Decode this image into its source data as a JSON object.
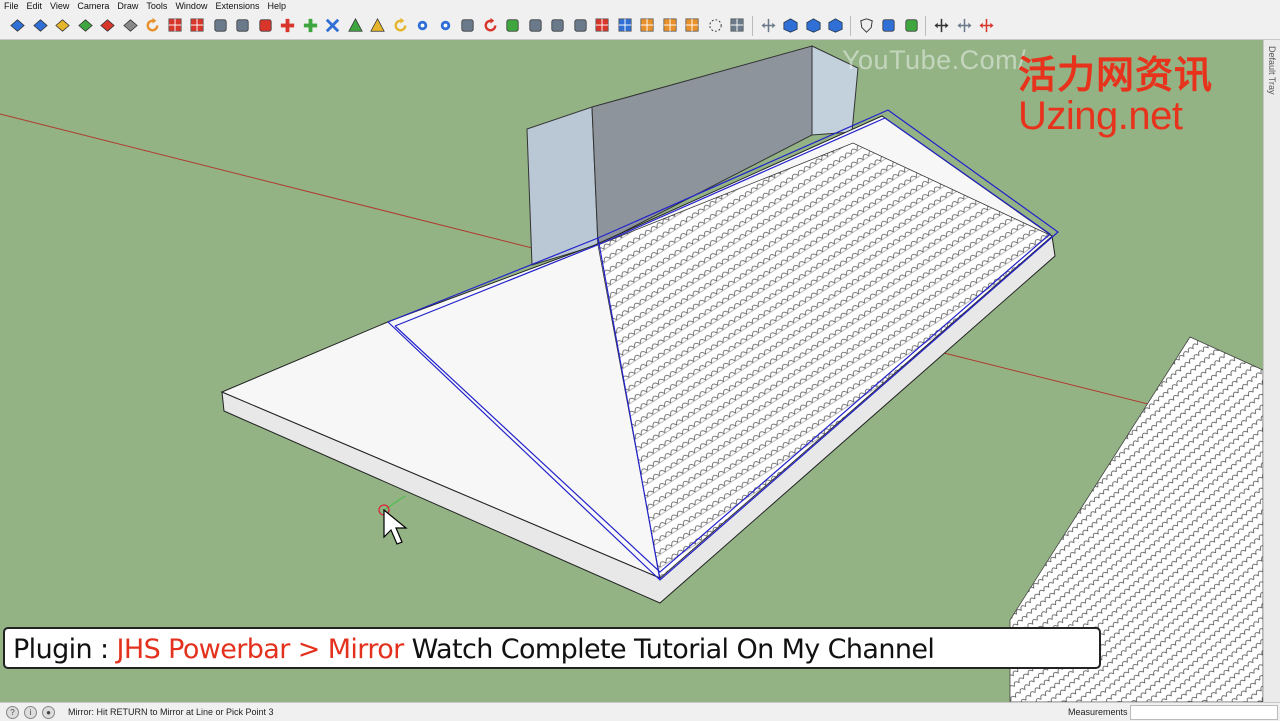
{
  "menu": [
    "File",
    "Edit",
    "View",
    "Camera",
    "Draw",
    "Tools",
    "Window",
    "Extensions",
    "Help"
  ],
  "toolbar": {
    "icons": [
      "push-pull-blue-icon",
      "face-blue-icon",
      "face-yellow-icon",
      "face-green-icon",
      "face-red-icon",
      "face-outline-icon",
      "rotate-orange-icon",
      "grid-red-icon",
      "grid-red-2-icon",
      "flag-icon",
      "corner-icon",
      "curve-red-icon",
      "add-red-icon",
      "add-green-icon",
      "cross-blue-icon",
      "triangle-green-icon",
      "warning-yellow-icon",
      "refresh-yellow-icon",
      "gear-blue-icon",
      "star-blue-icon",
      "bucket-icon",
      "undo-red-icon",
      "puzzle-green-icon",
      "flip-icon",
      "shapes-icon",
      "paint-icon",
      "tile-red-icon",
      "grid-blue-icon",
      "grid-orange-icon",
      "grid-orange-2-icon",
      "grid-orange-3-icon",
      "dotted-circle-icon",
      "dotted-grid-icon",
      "move-icon",
      "cube-blue-icon",
      "cube-blue-2-icon",
      "cube-blue-3-icon",
      "shield-icon",
      "pen-blue-icon",
      "pen-green-icon",
      "arrows-black-icon",
      "mirror-icon",
      "mirror-red-icon"
    ]
  },
  "tray": {
    "label": "Default Tray"
  },
  "watermark": {
    "youtube": "YouTube.Com/",
    "cn": "活力网资讯",
    "site": "Uzing.net"
  },
  "caption": {
    "part1": "Plugin : ",
    "part2": "JHS Powerbar > Mirror",
    "part3": " Watch Complete Tutorial On My Channel"
  },
  "status": {
    "message": "Mirror:  Hit RETURN to Mirror at Line or Pick Point 3",
    "measurements_label": "Measurements",
    "measurements_value": ""
  },
  "colors": {
    "background": "#93b385",
    "selection": "#2222cc",
    "caption_red": "#e3311d",
    "watermark_red": "#e8331c"
  }
}
